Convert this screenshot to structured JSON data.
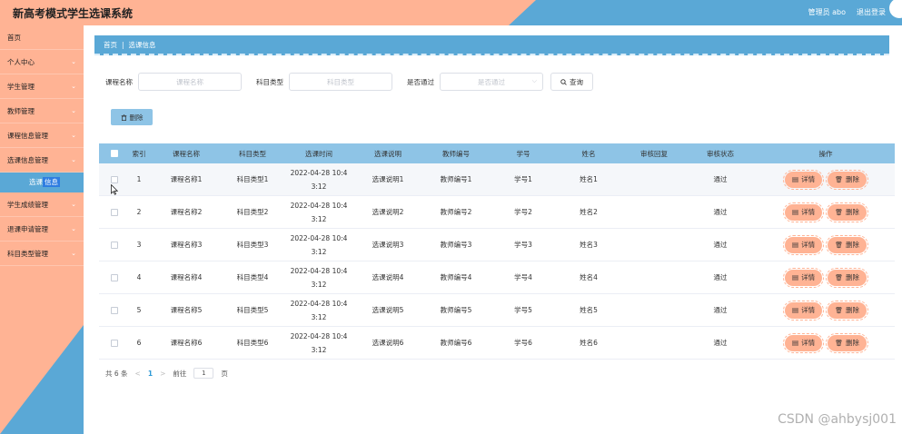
{
  "app": {
    "title": "新高考模式学生选课系统"
  },
  "header": {
    "role_user": "管理员 abo",
    "logout": "退出登录"
  },
  "sidebar": {
    "items": [
      {
        "label": "首页",
        "chevron": false
      },
      {
        "label": "个人中心",
        "chevron": true
      },
      {
        "label": "学生管理",
        "chevron": true
      },
      {
        "label": "教师管理",
        "chevron": true
      },
      {
        "label": "课程信息管理",
        "chevron": true
      },
      {
        "label": "选课信息管理",
        "chevron": true
      }
    ],
    "submenu_prefix": "选课",
    "submenu_highlight": "信息",
    "items_after": [
      {
        "label": "学生成绩管理",
        "chevron": true
      },
      {
        "label": "退课申请管理",
        "chevron": true
      },
      {
        "label": "科目类型管理",
        "chevron": true
      }
    ]
  },
  "breadcrumb": {
    "home": "首页",
    "separator": "|",
    "current": "选课信息"
  },
  "search": {
    "course_label": "课程名称",
    "course_placeholder": "课程名称",
    "type_label": "科目类型",
    "type_placeholder": "科目类型",
    "pass_label": "是否通过",
    "pass_placeholder": "是否通过",
    "query_label": "查询"
  },
  "actions": {
    "delete_label": "删除"
  },
  "table": {
    "headers": [
      "索引",
      "课程名称",
      "科目类型",
      "选课时间",
      "选课说明",
      "教师编号",
      "学号",
      "姓名",
      "审核回复",
      "审核状态",
      "操作"
    ],
    "rows": [
      {
        "idx": "1",
        "name": "课程名称1",
        "type": "科目类型1",
        "time_a": "2022-04-28 10:4",
        "time_b": "3:12",
        "desc": "选课说明1",
        "tno": "教师编号1",
        "sno": "学号1",
        "sname": "姓名1",
        "reply": "",
        "status": "通过"
      },
      {
        "idx": "2",
        "name": "课程名称2",
        "type": "科目类型2",
        "time_a": "2022-04-28 10:4",
        "time_b": "3:12",
        "desc": "选课说明2",
        "tno": "教师编号2",
        "sno": "学号2",
        "sname": "姓名2",
        "reply": "",
        "status": "通过"
      },
      {
        "idx": "3",
        "name": "课程名称3",
        "type": "科目类型3",
        "time_a": "2022-04-28 10:4",
        "time_b": "3:12",
        "desc": "选课说明3",
        "tno": "教师编号3",
        "sno": "学号3",
        "sname": "姓名3",
        "reply": "",
        "status": "通过"
      },
      {
        "idx": "4",
        "name": "课程名称4",
        "type": "科目类型4",
        "time_a": "2022-04-28 10:4",
        "time_b": "3:12",
        "desc": "选课说明4",
        "tno": "教师编号4",
        "sno": "学号4",
        "sname": "姓名4",
        "reply": "",
        "status": "通过"
      },
      {
        "idx": "5",
        "name": "课程名称5",
        "type": "科目类型5",
        "time_a": "2022-04-28 10:4",
        "time_b": "3:12",
        "desc": "选课说明5",
        "tno": "教师编号5",
        "sno": "学号5",
        "sname": "姓名5",
        "reply": "",
        "status": "通过"
      },
      {
        "idx": "6",
        "name": "课程名称6",
        "type": "科目类型6",
        "time_a": "2022-04-28 10:4",
        "time_b": "3:12",
        "desc": "选课说明6",
        "tno": "教师编号6",
        "sno": "学号6",
        "sname": "姓名6",
        "reply": "",
        "status": "通过"
      }
    ],
    "detail_label": "详情",
    "delete_label": "删除"
  },
  "pagination": {
    "total": "共 6 条",
    "prev": "<",
    "current": "1",
    "next": ">",
    "goto": "前往",
    "page_value": "1",
    "page_unit": "页"
  },
  "watermark": "CSDN @ahbysj001",
  "colors": {
    "peach": "#ffb394",
    "blue": "#5aa8d6",
    "header_row": "#8ec4e6"
  },
  "icons": {
    "chevron": "chevron-down-icon",
    "search": "search-icon",
    "trash": "trash-icon",
    "detail": "document-icon"
  }
}
